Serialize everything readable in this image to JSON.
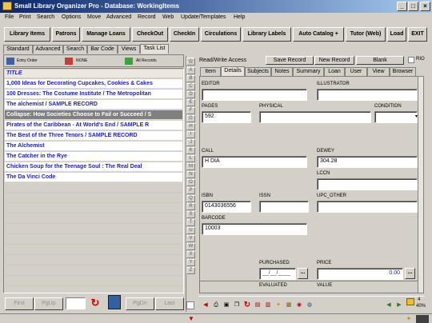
{
  "window": {
    "title": "Small Library Organizer Pro - Database: WorkingItems",
    "min": "_",
    "max": "□",
    "close": "×"
  },
  "menu": [
    "File",
    "Print",
    "Search",
    "Options",
    "Move",
    "Advanced",
    "Record",
    "Web",
    "Update/Templates",
    "Help"
  ],
  "toolbar": [
    "Library Items",
    "Patrons",
    "Manage Loans",
    "CheckOut",
    "CheckIn",
    "Circulations",
    "Library Labels",
    "Auto Catalog +",
    "Tutor (Web)",
    "Load",
    "EXIT"
  ],
  "search_tabs": [
    "Standard",
    "Advanced",
    "Search",
    "Bar Code",
    "Views",
    "Task List"
  ],
  "list_toolbar": {
    "entry_order": "Entry Order",
    "none": "NONE",
    "all_records": "All Records"
  },
  "list_header": "TITLE",
  "list_items": [
    "1,000 Ideas for Decorating Cupcakes, Cookies & Cakes",
    "100 Dresses: The Costume Institute / The Metropolitan",
    "The alchemist / SAMPLE RECORD",
    "Collapse: How Societies Choose to Fail or Succeed / S",
    "Pirates of the Caribbean - At World's End / SAMPLE R",
    "The Best of the Three Tenors / SAMPLE RECORD",
    "The Alchemist",
    "The Catcher in the Rye",
    "Chicken Soup for the Teenage Soul : The Real Deal",
    "The Da Vinci Code"
  ],
  "selected_index": 3,
  "alphabet": [
    "A",
    "B",
    "C",
    "D",
    "E",
    "F",
    "G",
    "H",
    "I",
    "J",
    "K",
    "L",
    "M",
    "N",
    "O",
    "P",
    "Q",
    "R",
    "S",
    "T",
    "U",
    "V",
    "W",
    "X",
    "Y",
    "Z"
  ],
  "nav": {
    "first": "First",
    "pgup": "PgUp",
    "pgdn": "PgDn",
    "last": "Last"
  },
  "record_bar": {
    "mode": "Read/Write Access",
    "save": "Save Record",
    "new": "New Record",
    "blank": "Blank",
    "rio": "RIO"
  },
  "record_tabs": [
    "Item",
    "Details",
    "Subjects",
    "Notes",
    "Summary",
    "Loan",
    "User",
    "View",
    "Browser"
  ],
  "active_record_tab": "Details",
  "fields": {
    "editor": {
      "label": "EDITOR",
      "value": ""
    },
    "illustrator": {
      "label": "ILLUSTRATOR",
      "value": ""
    },
    "pages": {
      "label": "PAGES",
      "value": "592"
    },
    "physical": {
      "label": "PHYSICAL",
      "value": ""
    },
    "condition": {
      "label": "CONDITION",
      "value": ""
    },
    "call": {
      "label": "CALL",
      "value": "H DIA"
    },
    "dewey": {
      "label": "DEWEY",
      "value": "304.28"
    },
    "lccn": {
      "label": "LCCN",
      "value": ""
    },
    "isbn": {
      "label": "ISBN",
      "value": "0143036556"
    },
    "issn": {
      "label": "ISSN",
      "value": ""
    },
    "upc_other": {
      "label": "UPC_OTHER",
      "value": ""
    },
    "barcode": {
      "label": "BARCODE",
      "value": "10003"
    },
    "purchased": {
      "label": "PURCHASED",
      "value": "__/__/____"
    },
    "price": {
      "label": "PRICE",
      "value": "0.00"
    },
    "evaluated": {
      "label": "EVALUATED"
    },
    "value": {
      "label": "VALUE"
    }
  },
  "status": {
    "record": "4",
    "percent": "40%"
  },
  "colors": {
    "title_start": "#0a246a",
    "title_end": "#a6caf0",
    "list_text": "#2020c0",
    "selected_bg": "#808080"
  }
}
